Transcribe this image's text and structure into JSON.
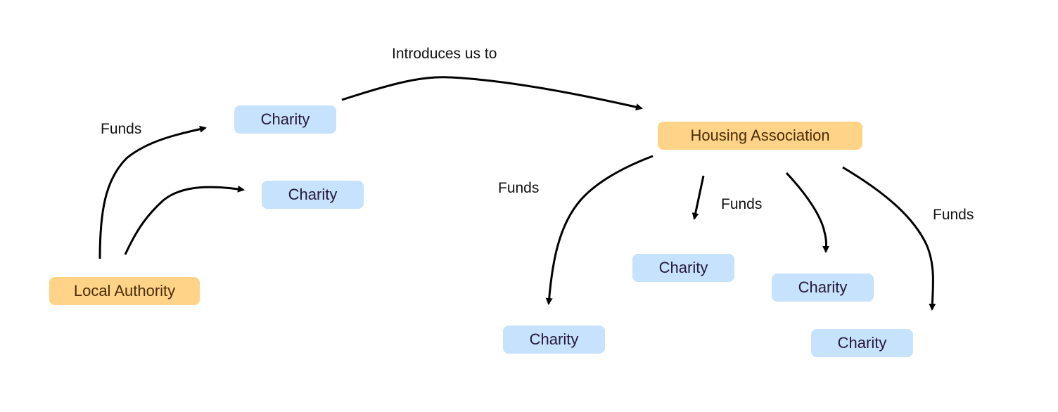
{
  "nodes": {
    "local_authority": "Local Authority",
    "housing_association": "Housing Association",
    "charity_1": "Charity",
    "charity_2": "Charity",
    "charity_3": "Charity",
    "charity_4": "Charity",
    "charity_5": "Charity",
    "charity_6": "Charity"
  },
  "edge_labels": {
    "la_funds": "Funds",
    "introduces": "Introduces us to",
    "ha_funds_left": "Funds",
    "ha_funds_mid": "Funds",
    "ha_funds_right": "Funds"
  },
  "edges": [
    {
      "from": "local_authority",
      "to": "charity_1",
      "label": "la_funds"
    },
    {
      "from": "local_authority",
      "to": "charity_2"
    },
    {
      "from": "charity_1",
      "to": "housing_association",
      "label": "introduces"
    },
    {
      "from": "housing_association",
      "to": "charity_3",
      "label": "ha_funds_left"
    },
    {
      "from": "housing_association",
      "to": "charity_4",
      "label": "ha_funds_mid"
    },
    {
      "from": "housing_association",
      "to": "charity_5"
    },
    {
      "from": "housing_association",
      "to": "charity_6",
      "label": "ha_funds_right"
    }
  ],
  "colors": {
    "org_fill": "#ffd488",
    "charity_fill": "#c7e2fd",
    "edge": "#000000"
  }
}
